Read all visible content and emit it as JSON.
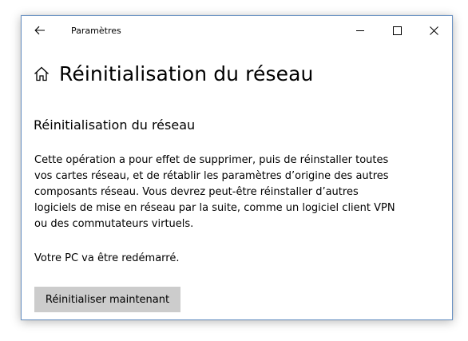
{
  "window": {
    "app_title": "Paramètres",
    "back_icon": "back-arrow-icon",
    "controls": {
      "minimize_icon": "minimize-icon",
      "maximize_icon": "maximize-icon",
      "close_icon": "close-icon"
    }
  },
  "header": {
    "home_icon": "home-icon",
    "title": "Réinitialisation du réseau"
  },
  "main": {
    "section_title": "Réinitialisation du réseau",
    "description": "Cette opération a pour effet de supprimer, puis de réinstaller toutes vos cartes réseau, et de rétablir les paramètres d’origine des autres composants réseau. Vous devrez peut-être réinstaller d’autres logiciels de mise en réseau par la suite, comme un logiciel client VPN ou des commutateurs virtuels.",
    "restart_note": "Votre PC va être redémarré.",
    "reset_button_label": "Réinitialiser maintenant"
  },
  "colors": {
    "window_border": "#6b93c4",
    "button_bg": "#cccccc"
  }
}
